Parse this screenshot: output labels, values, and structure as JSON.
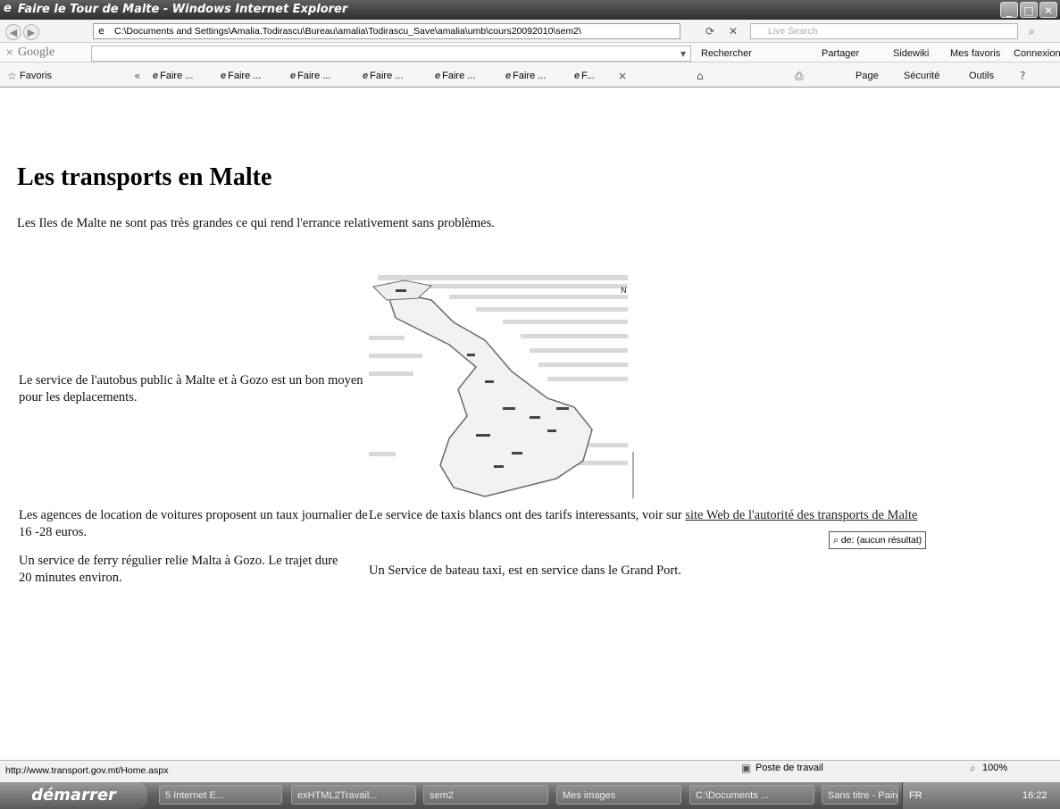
{
  "window": {
    "title": "Faire le Tour de Malte - Windows Internet Explorer"
  },
  "address_bar": {
    "url": "C:\\Documents and Settings\\Amalia.Todirascu\\Bureau\\amalia\\Todirascu_Save\\amalia\\umb\\cours20092010\\sem2\\",
    "search_placeholder": "Live Search"
  },
  "google_toolbar": {
    "logo": "Google",
    "items": [
      "Rechercher",
      "Partager",
      "Sidewiki",
      "Mes favoris",
      "Connexion"
    ]
  },
  "favorites_bar": {
    "favorites_label": "Favoris",
    "tabs": [
      "Faire ...",
      "Faire ...",
      "Faire ...",
      "Faire ...",
      "Faire ...",
      "Faire ...",
      "F..."
    ],
    "commands": [
      "Page",
      "Sécurité",
      "Outils"
    ]
  },
  "page": {
    "heading": "Les transports en Malte",
    "intro": "Les Iles de Malte ne sont pas très grandes ce qui rend l'errance relativement sans problèmes.",
    "bus": "Le service de l'autobus public à Malte et à Gozo est un bon moyen pour les deplacements.",
    "rental": "Les agences de location de voitures proposent un taux journalier de 16 -28 euros.",
    "ferry": "Un service de ferry régulier relie Malta à Gozo. Le trajet dure 20 minutes environ.",
    "taxi_prefix": "Le service de taxis blancs ont des tarifs interessants, voir sur ",
    "taxi_link": "site Web de l'autorité des transports de Malte",
    "boat": "Un Service de bateau taxi, est en service dans le Grand Port.",
    "tooltip": "de: (aucun résultat)"
  },
  "status_bar": {
    "url": "http://www.transport.gov.mt/Home.aspx",
    "zone": "Poste de travail",
    "zoom": "100%"
  },
  "taskbar": {
    "start": "démarrer",
    "buttons": [
      "5 Internet E...",
      "exHTML2Travail...",
      "sem2",
      "Mes images",
      "C:\\Documents ...",
      "Sans titre - Paint"
    ],
    "language": "FR",
    "clock": "16:22"
  }
}
